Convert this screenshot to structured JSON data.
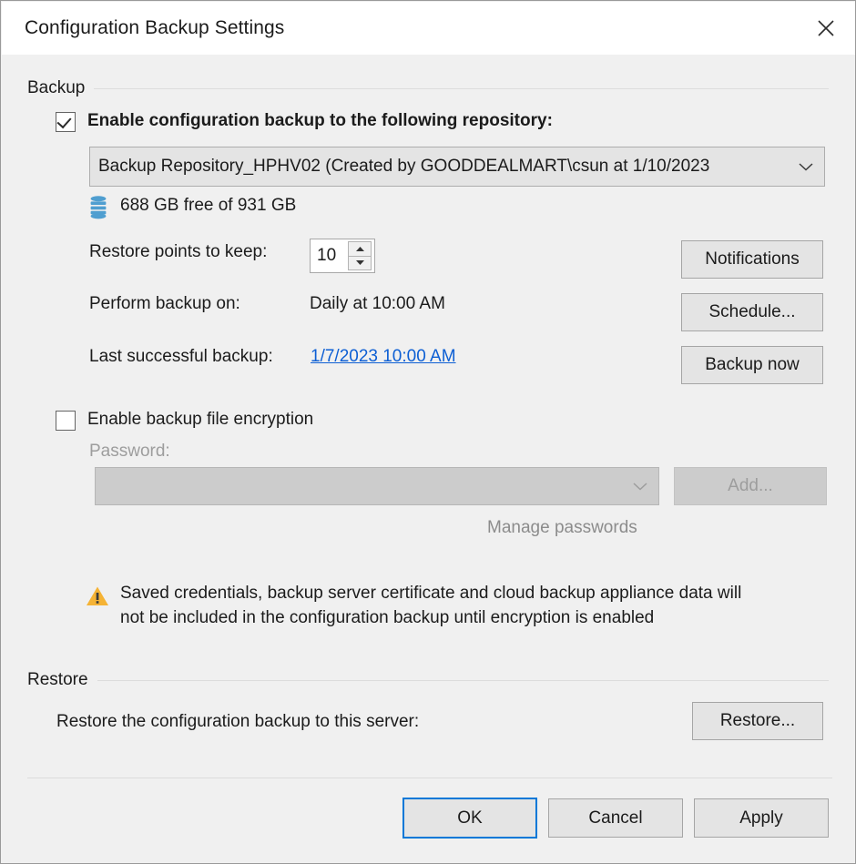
{
  "window": {
    "title": "Configuration Backup Settings",
    "close_icon": "close-icon"
  },
  "backup_group": {
    "label": "Backup",
    "enable_checkbox": {
      "label": "Enable configuration backup to the following repository:",
      "checked": true
    },
    "repository_combo": {
      "value": "Backup Repository_HPHV02 (Created by GOODDEALMART\\csun at 1/10/2023",
      "arrow_icon": "chevron-down-icon"
    },
    "repository_capacity": {
      "icon": "repository-disk-icon",
      "text": "688 GB free of 931 GB"
    },
    "restore_points": {
      "label": "Restore points to keep:",
      "value": "10",
      "up_icon": "caret-up-icon",
      "down_icon": "caret-down-icon"
    },
    "perform_backup": {
      "label": "Perform backup on:",
      "value": "Daily at 10:00 AM"
    },
    "last_backup": {
      "label": "Last successful backup:",
      "value": "1/7/2023 10:00 AM"
    },
    "side_buttons": {
      "notifications": "Notifications",
      "schedule": "Schedule...",
      "backup_now": "Backup now"
    },
    "encryption_checkbox": {
      "label": "Enable backup file encryption",
      "checked": false
    },
    "password": {
      "label": "Password:",
      "value": "",
      "arrow_icon": "chevron-down-icon",
      "add_button": "Add...",
      "manage_link": "Manage passwords"
    },
    "warning": {
      "icon": "warning-triangle-icon",
      "text": "Saved credentials, backup server certificate and cloud backup appliance data will not be included in the configuration backup until encryption is enabled"
    }
  },
  "restore_group": {
    "label": "Restore",
    "description": "Restore the configuration backup to this server:",
    "restore_button": "Restore..."
  },
  "footer": {
    "ok": "OK",
    "cancel": "Cancel",
    "apply": "Apply"
  },
  "colors": {
    "accent": "#0078d7",
    "link": "#0d5fd4",
    "warning": "#f5b335",
    "repo_icon": "#3c8fc4"
  }
}
